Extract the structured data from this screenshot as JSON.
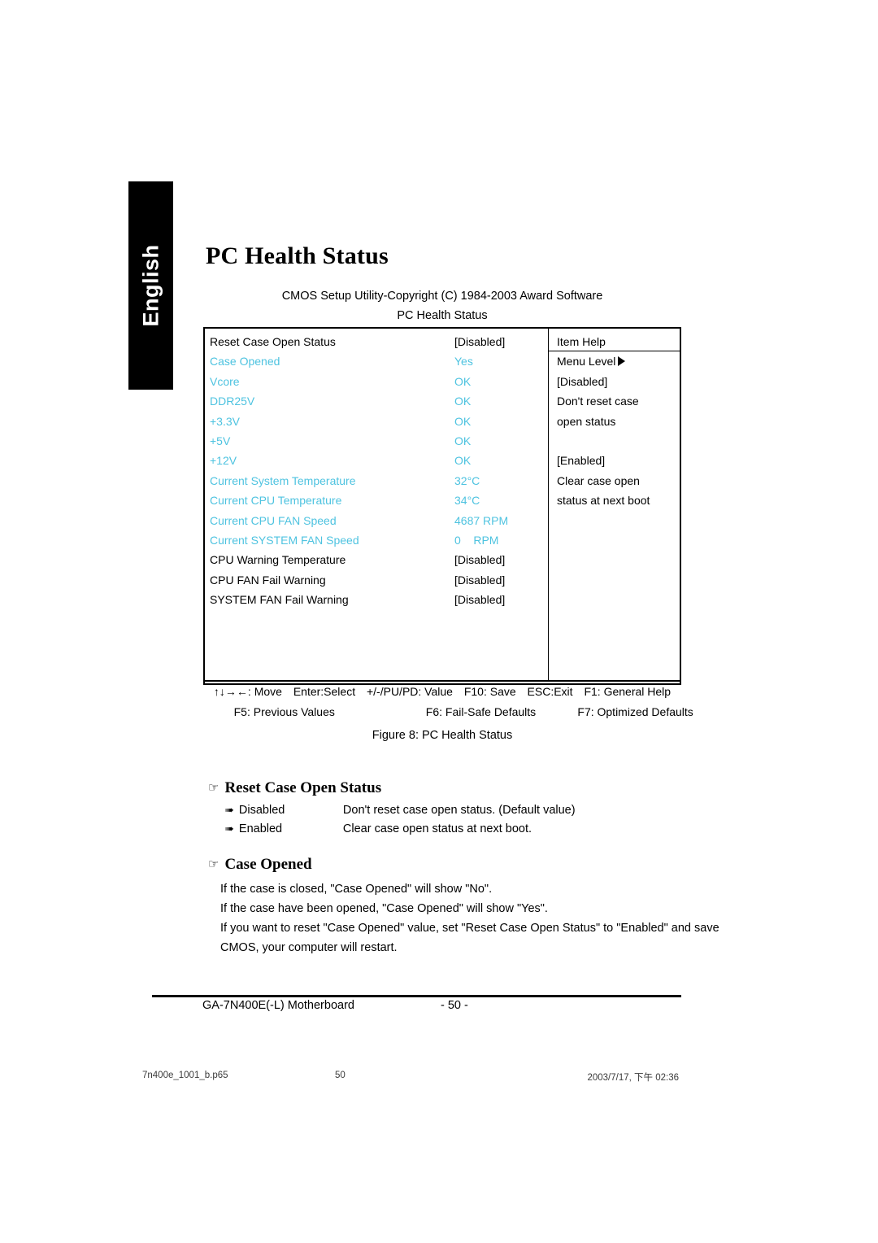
{
  "sidebar_tab": {
    "label": "English"
  },
  "page_title": "PC Health Status",
  "bios": {
    "header_line1": "CMOS Setup Utility-Copyright (C) 1984-2003 Award Software",
    "header_line2": "PC Health Status",
    "rows": [
      {
        "name": "Reset Case Open Status",
        "value": "[Disabled]",
        "cyan": false
      },
      {
        "name": "Case Opened",
        "value": "Yes",
        "cyan": true
      },
      {
        "name": "Vcore",
        "value": "OK",
        "cyan": true
      },
      {
        "name": "DDR25V",
        "value": "OK",
        "cyan": true
      },
      {
        "name": "+3.3V",
        "value": "OK",
        "cyan": true
      },
      {
        "name": "+5V",
        "value": "OK",
        "cyan": true
      },
      {
        "name": "+12V",
        "value": "OK",
        "cyan": true
      },
      {
        "name": "Current System Temperature",
        "value": "32°C",
        "cyan": true
      },
      {
        "name": "Current CPU Temperature",
        "value": "34°C",
        "cyan": true
      },
      {
        "name": "Current CPU FAN Speed",
        "value": "4687 RPM",
        "cyan": true
      },
      {
        "name": "Current SYSTEM FAN Speed",
        "value": "0    RPM",
        "cyan": true
      },
      {
        "name": "CPU Warning Temperature",
        "value": "[Disabled]",
        "cyan": false
      },
      {
        "name": "CPU FAN Fail Warning",
        "value": "[Disabled]",
        "cyan": false
      },
      {
        "name": "SYSTEM FAN Fail Warning",
        "value": "[Disabled]",
        "cyan": false
      }
    ],
    "help": {
      "title": "Item Help",
      "menu_level": "Menu Level",
      "lines": [
        "[Disabled]",
        "Don't reset case",
        "open status",
        "",
        "[Enabled]",
        "Clear case open",
        "status at next boot"
      ]
    },
    "legend": {
      "line1": [
        "↑↓→←: Move",
        "Enter:Select",
        "+/-/PU/PD: Value",
        "F10: Save",
        "ESC:Exit",
        "F1: General Help"
      ],
      "line2": [
        "F5: Previous Values",
        "F6: Fail-Safe Defaults",
        "F7: Optimized Defaults"
      ]
    },
    "accent_cyan": "#4EC3E0"
  },
  "figure_caption": "Figure 8: PC Health Status",
  "sections": [
    {
      "heading": "Reset Case Open Status",
      "options": [
        {
          "name": "Disabled",
          "desc": "Don't reset case open status. (Default value)"
        },
        {
          "name": "Enabled",
          "desc": "Clear case open status at next boot."
        }
      ]
    },
    {
      "heading": "Case Opened",
      "paragraph_lines": [
        "If the case is closed, \"Case Opened\" will show \"No\".",
        "If the case have been opened, \"Case Opened\" will show \"Yes\".",
        "If you want to reset \"Case Opened\" value, set \"Reset Case Open Status\" to \"Enabled\" and save",
        "CMOS, your computer will restart."
      ]
    }
  ],
  "footer": {
    "product": "GA-7N400E(-L) Motherboard",
    "page_number": "- 50 -"
  },
  "print_strip": {
    "file": "7n400e_1001_b.p65",
    "page": "50",
    "date": "2003/7/17, 下午 02:36"
  }
}
